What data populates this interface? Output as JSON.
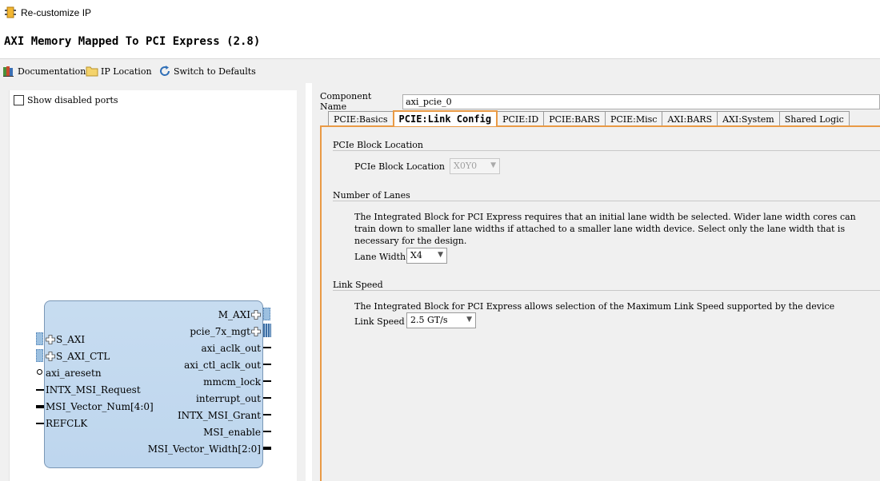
{
  "window": {
    "title": "Re-customize IP"
  },
  "ip": {
    "title": "AXI Memory Mapped To PCI Express (2.8)"
  },
  "toolbar": {
    "documentation": "Documentation",
    "ip_location": "IP Location",
    "switch_defaults": "Switch to Defaults"
  },
  "left": {
    "show_disabled_ports": "Show disabled ports",
    "ports_left": [
      "S_AXI",
      "S_AXI_CTL",
      "axi_aresetn",
      "INTX_MSI_Request",
      "MSI_Vector_Num[4:0]",
      "REFCLK"
    ],
    "ports_right": [
      "M_AXI",
      "pcie_7x_mgt",
      "axi_aclk_out",
      "axi_ctl_aclk_out",
      "mmcm_lock",
      "interrupt_out",
      "INTX_MSI_Grant",
      "MSI_enable",
      "MSI_Vector_Width[2:0]"
    ]
  },
  "component": {
    "label": "Component Name",
    "value": "axi_pcie_0"
  },
  "tabs": [
    "PCIE:Basics",
    "PCIE:Link Config",
    "PCIE:ID",
    "PCIE:BARS",
    "PCIE:Misc",
    "AXI:BARS",
    "AXI:System",
    "Shared Logic"
  ],
  "active_tab": "PCIE:Link Config",
  "link_config": {
    "block_location": {
      "section": "PCIe Block Location",
      "label": "PCIe Block Location",
      "value": "X0Y0"
    },
    "lanes": {
      "section": "Number of Lanes",
      "description": "The Integrated Block for PCI Express requires that an initial lane width be selected. Wider lane width cores can train down to smaller lane widths if attached to a smaller lane width device. Select only the lane width that is necessary for the design.",
      "label": "Lane Width",
      "value": "X4"
    },
    "speed": {
      "section": "Link Speed",
      "description": "The Integrated Block for PCI Express allows selection of the Maximum Link Speed supported by the device",
      "label": "Link Speed",
      "value": "2.5 GT/s"
    }
  },
  "colors": {
    "accent": "#e99a45",
    "block_fill": "#c7dcf0",
    "block_border": "#7a97b6"
  },
  "icons": [
    "vivado-ip-icon",
    "documentation-icon",
    "folder-icon",
    "refresh-icon",
    "plus-icon"
  ]
}
